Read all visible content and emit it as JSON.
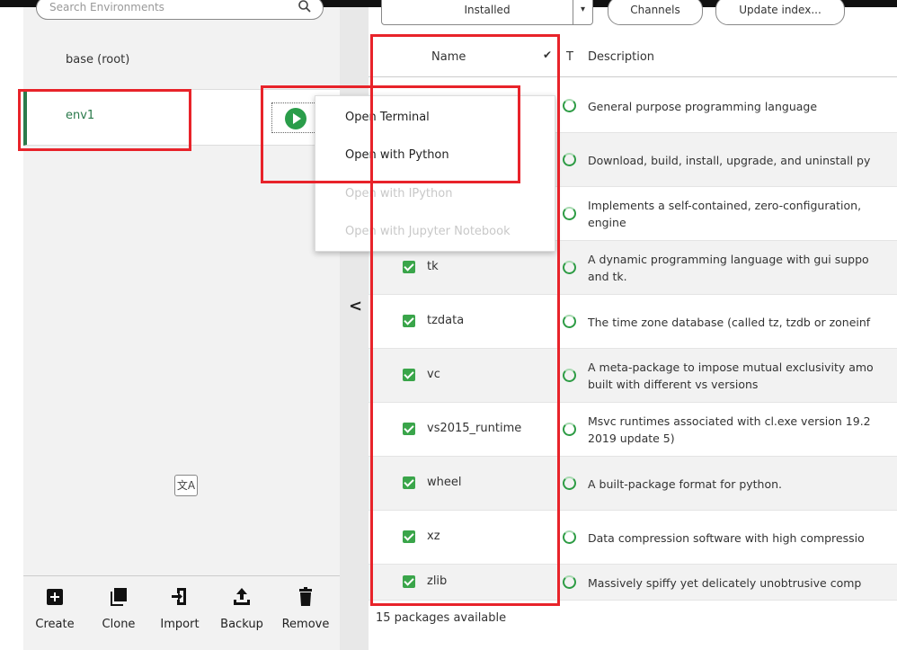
{
  "environments": {
    "search_placeholder": "Search Environments",
    "items": [
      {
        "label": "base (root)",
        "selected": false
      },
      {
        "label": "env1",
        "selected": true
      }
    ]
  },
  "context_menu": {
    "items": [
      {
        "label": "Open Terminal",
        "enabled": true
      },
      {
        "label": "Open with Python",
        "enabled": true
      },
      {
        "label": "Open with IPython",
        "enabled": false
      },
      {
        "label": "Open with Jupyter Notebook",
        "enabled": false
      }
    ]
  },
  "toolbar": {
    "filter_value": "Installed",
    "channels_label": "Channels",
    "update_index_label": "Update index..."
  },
  "bottom_tools": [
    {
      "label": "Create",
      "icon": "plus-square-icon"
    },
    {
      "label": "Clone",
      "icon": "clone-icon"
    },
    {
      "label": "Import",
      "icon": "import-icon"
    },
    {
      "label": "Backup",
      "icon": "upload-icon"
    },
    {
      "label": "Remove",
      "icon": "trash-icon"
    }
  ],
  "table": {
    "headers": {
      "name": "Name",
      "type": "T",
      "description": "Description"
    },
    "rows": [
      {
        "name": "",
        "description": [
          "General purpose programming language"
        ]
      },
      {
        "name": "",
        "description": [
          "Download, build, install, upgrade, and uninstall py"
        ]
      },
      {
        "name": "",
        "description": [
          "Implements a self-contained, zero-configuration,",
          "engine"
        ]
      },
      {
        "name": "tk",
        "description": [
          "A dynamic programming language with gui suppo",
          "and tk."
        ]
      },
      {
        "name": "tzdata",
        "description": [
          "The time zone database (called tz, tzdb or zoneinf"
        ]
      },
      {
        "name": "vc",
        "description": [
          "A meta-package to impose mutual exclusivity amo",
          "built with different vs versions"
        ]
      },
      {
        "name": "vs2015_runtime",
        "description": [
          "Msvc runtimes associated with cl.exe version 19.2",
          "2019 update 5)"
        ]
      },
      {
        "name": "wheel",
        "description": [
          "A built-package format for python."
        ]
      },
      {
        "name": "xz",
        "description": [
          "Data compression software with high compressio"
        ]
      },
      {
        "name": "zlib",
        "description": [
          "Massively spiffy yet delicately unobtrusive comp"
        ]
      }
    ]
  },
  "footer": {
    "status": "15 packages available"
  },
  "translate_label": "文A",
  "colors": {
    "accent_green": "#2a7a4b",
    "check_green": "#3aa54a",
    "annotation_red": "#e8232a"
  }
}
